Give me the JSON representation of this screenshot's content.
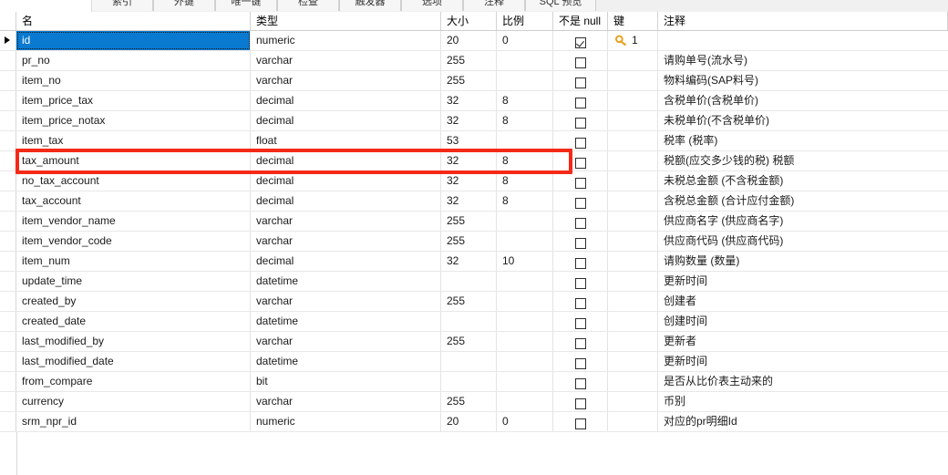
{
  "toolbar": {
    "tabs": [
      "索引",
      "外键",
      "唯一键",
      "检查",
      "触发器",
      "选项",
      "注释",
      "SQL 预览"
    ]
  },
  "grid": {
    "headers": {
      "name": "名",
      "type": "类型",
      "size": "大小",
      "scale": "比例",
      "not_null": "不是 null",
      "key": "键",
      "comment": "注释"
    },
    "selected_row_index": 0,
    "highlighted_row_index": 6,
    "rows": [
      {
        "name": "id",
        "type": "numeric",
        "size": "20",
        "scale": "0",
        "not_null": true,
        "key": "1",
        "comment": ""
      },
      {
        "name": "pr_no",
        "type": "varchar",
        "size": "255",
        "scale": "",
        "not_null": false,
        "key": "",
        "comment": "请购单号(流水号)"
      },
      {
        "name": "item_no",
        "type": "varchar",
        "size": "255",
        "scale": "",
        "not_null": false,
        "key": "",
        "comment": "物料编码(SAP料号)"
      },
      {
        "name": "item_price_tax",
        "type": "decimal",
        "size": "32",
        "scale": "8",
        "not_null": false,
        "key": "",
        "comment": "含税单价(含税单价)"
      },
      {
        "name": "item_price_notax",
        "type": "decimal",
        "size": "32",
        "scale": "8",
        "not_null": false,
        "key": "",
        "comment": "未税单价(不含税单价)"
      },
      {
        "name": "item_tax",
        "type": "float",
        "size": "53",
        "scale": "",
        "not_null": false,
        "key": "",
        "comment": "税率 (税率)"
      },
      {
        "name": "tax_amount",
        "type": "decimal",
        "size": "32",
        "scale": "8",
        "not_null": false,
        "key": "",
        "comment": "税额(应交多少钱的税)  税额"
      },
      {
        "name": "no_tax_account",
        "type": "decimal",
        "size": "32",
        "scale": "8",
        "not_null": false,
        "key": "",
        "comment": "未税总金额 (不含税金额)"
      },
      {
        "name": "tax_account",
        "type": "decimal",
        "size": "32",
        "scale": "8",
        "not_null": false,
        "key": "",
        "comment": "含税总金额 (合计应付金额)"
      },
      {
        "name": "item_vendor_name",
        "type": "varchar",
        "size": "255",
        "scale": "",
        "not_null": false,
        "key": "",
        "comment": "供应商名字 (供应商名字)"
      },
      {
        "name": "item_vendor_code",
        "type": "varchar",
        "size": "255",
        "scale": "",
        "not_null": false,
        "key": "",
        "comment": "供应商代码  (供应商代码)"
      },
      {
        "name": "item_num",
        "type": "decimal",
        "size": "32",
        "scale": "10",
        "not_null": false,
        "key": "",
        "comment": "请购数量 (数量)"
      },
      {
        "name": "update_time",
        "type": "datetime",
        "size": "",
        "scale": "",
        "not_null": false,
        "key": "",
        "comment": "更新时间"
      },
      {
        "name": "created_by",
        "type": "varchar",
        "size": "255",
        "scale": "",
        "not_null": false,
        "key": "",
        "comment": "创建者"
      },
      {
        "name": "created_date",
        "type": "datetime",
        "size": "",
        "scale": "",
        "not_null": false,
        "key": "",
        "comment": "创建时间"
      },
      {
        "name": "last_modified_by",
        "type": "varchar",
        "size": "255",
        "scale": "",
        "not_null": false,
        "key": "",
        "comment": "更新者"
      },
      {
        "name": "last_modified_date",
        "type": "datetime",
        "size": "",
        "scale": "",
        "not_null": false,
        "key": "",
        "comment": "更新时间"
      },
      {
        "name": "from_compare",
        "type": "bit",
        "size": "",
        "scale": "",
        "not_null": false,
        "key": "",
        "comment": "是否从比价表主动来的"
      },
      {
        "name": "currency",
        "type": "varchar",
        "size": "255",
        "scale": "",
        "not_null": false,
        "key": "",
        "comment": "币别"
      },
      {
        "name": "srm_npr_id",
        "type": "numeric",
        "size": "20",
        "scale": "0",
        "not_null": false,
        "key": "",
        "comment": "对应的pr明细Id"
      }
    ]
  },
  "annotation": {
    "color": "#F42A18",
    "target_field": "tax_amount"
  },
  "icons": {
    "key": "key-icon",
    "row_pointer": "row-pointer-icon",
    "checkbox_checked": "checkbox-checked-icon",
    "checkbox_unchecked": "checkbox-unchecked-icon"
  }
}
